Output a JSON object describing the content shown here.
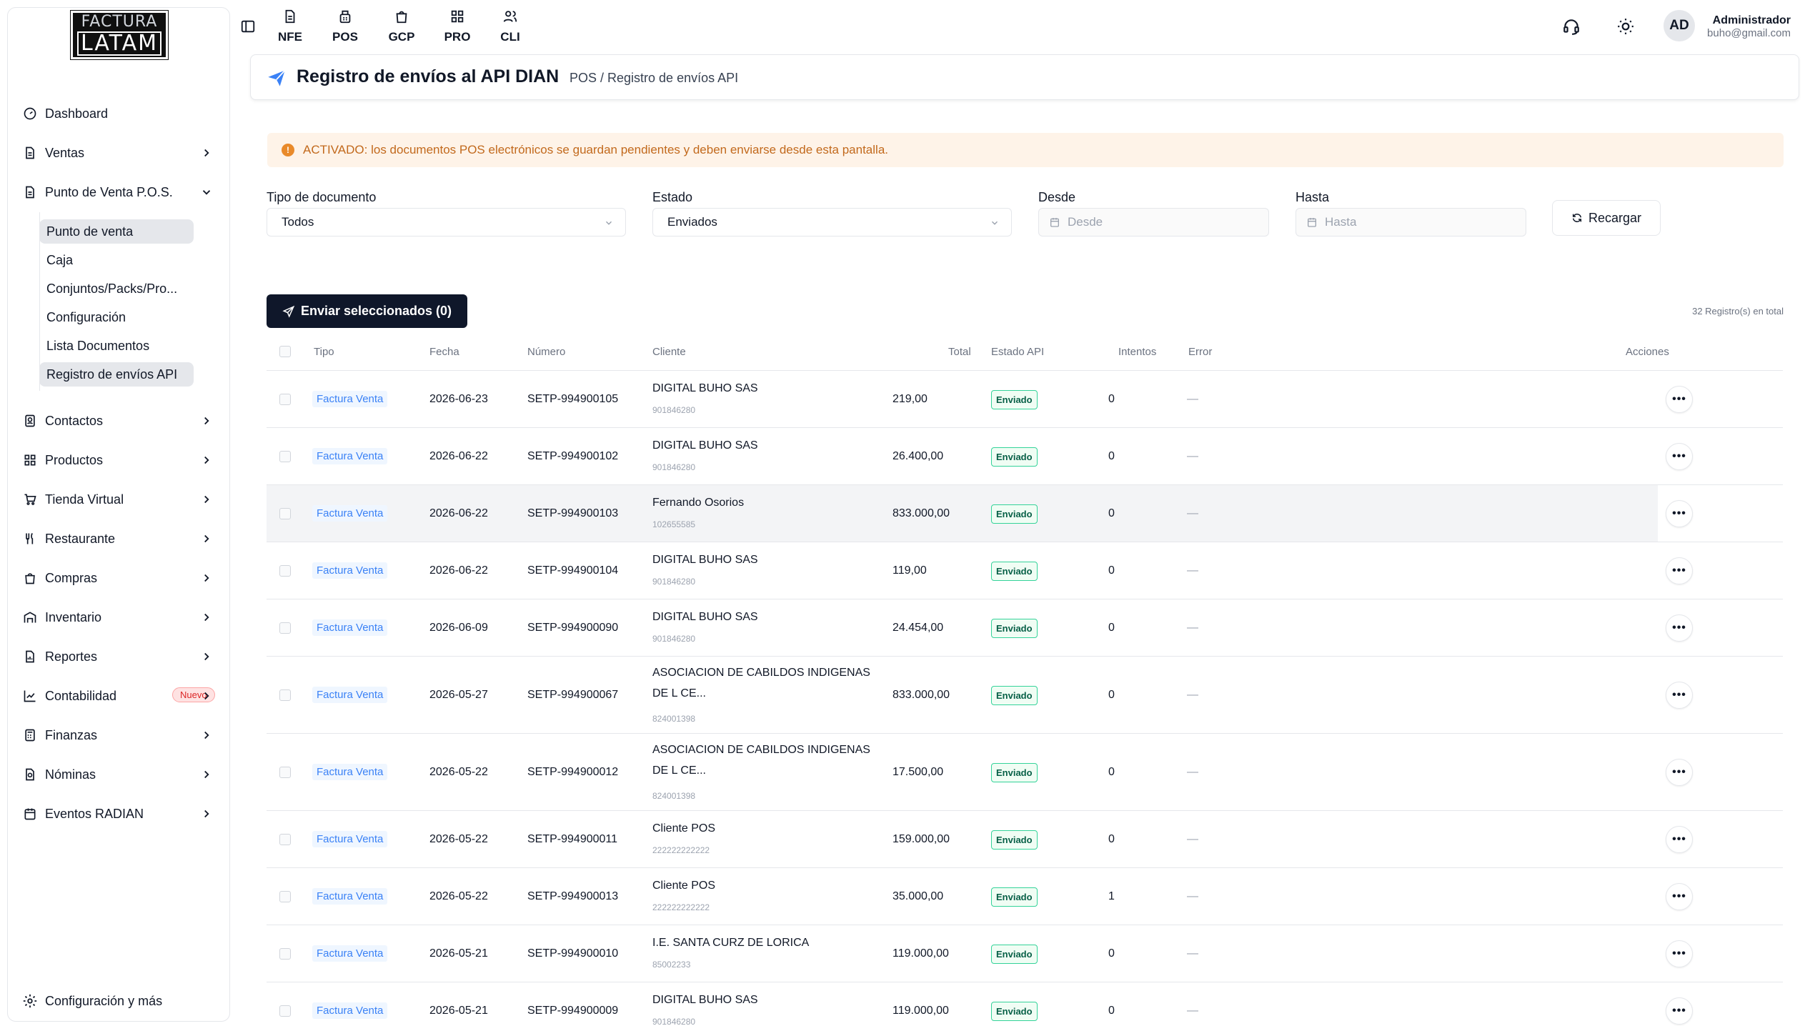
{
  "logo": {
    "line1": "FACTURA",
    "line2": "LATAM"
  },
  "sidebar": {
    "items": [
      {
        "label": "Dashboard",
        "icon": "gauge-icon"
      },
      {
        "label": "Ventas",
        "icon": "document-icon"
      },
      {
        "label": "Punto de Venta P.O.S.",
        "icon": "document-icon"
      },
      {
        "label": "Contactos",
        "icon": "contacts-icon"
      },
      {
        "label": "Productos",
        "icon": "grid-icon"
      },
      {
        "label": "Tienda Virtual",
        "icon": "cart-icon"
      },
      {
        "label": "Restaurante",
        "icon": "utensils-icon"
      },
      {
        "label": "Compras",
        "icon": "shopping-bag-icon"
      },
      {
        "label": "Inventario",
        "icon": "warehouse-icon"
      },
      {
        "label": "Reportes",
        "icon": "report-icon"
      },
      {
        "label": "Contabilidad",
        "icon": "chart-icon",
        "badge": "Nuevo"
      },
      {
        "label": "Finanzas",
        "icon": "calculator-icon"
      },
      {
        "label": "Nóminas",
        "icon": "payroll-icon"
      },
      {
        "label": "Eventos RADIAN",
        "icon": "calendar-icon"
      }
    ],
    "pos_sub": [
      "Punto de venta",
      "Caja",
      "Conjuntos/Packs/Pro...",
      "Configuración",
      "Lista Documentos",
      "Registro de envíos API"
    ],
    "footer": "Configuración y más"
  },
  "topbar": {
    "modules": [
      "NFE",
      "POS",
      "GCP",
      "PRO",
      "CLI"
    ],
    "avatar": "AD",
    "user_name": "Administrador",
    "user_email": "buho@gmail.com"
  },
  "header": {
    "title": "Registro de envíos al API DIAN",
    "breadcrumb": "POS / Registro de envíos API"
  },
  "alert": "ACTIVADO: los documentos POS electrónicos se guardan pendientes y deben enviarse desde esta pantalla.",
  "filters": {
    "tipo_label": "Tipo de documento",
    "tipo_value": "Todos",
    "estado_label": "Estado",
    "estado_value": "Enviados",
    "desde_label": "Desde",
    "desde_placeholder": "Desde",
    "hasta_label": "Hasta",
    "hasta_placeholder": "Hasta",
    "reload": "Recargar"
  },
  "send_selected": "Enviar seleccionados (0)",
  "records_total": "32 Registro(s) en total",
  "table": {
    "headers": {
      "tipo": "Tipo",
      "fecha": "Fecha",
      "numero": "Número",
      "cliente": "Cliente",
      "total": "Total",
      "estado": "Estado API",
      "intentos": "Intentos",
      "error": "Error",
      "acciones": "Acciones"
    },
    "rows": [
      {
        "tipo": "Factura Venta",
        "fecha": "2026-06-23",
        "numero": "SETP-994900105",
        "cliente": "DIGITAL BUHO SAS",
        "nit": "901846280",
        "total": "219,00",
        "estado": "Enviado",
        "intentos": "0",
        "error": "—"
      },
      {
        "tipo": "Factura Venta",
        "fecha": "2026-06-22",
        "numero": "SETP-994900102",
        "cliente": "DIGITAL BUHO SAS",
        "nit": "901846280",
        "total": "26.400,00",
        "estado": "Enviado",
        "intentos": "0",
        "error": "—"
      },
      {
        "tipo": "Factura Venta",
        "fecha": "2026-06-22",
        "numero": "SETP-994900103",
        "cliente": "Fernando Osorios",
        "nit": "102655585",
        "total": "833.000,00",
        "estado": "Enviado",
        "intentos": "0",
        "error": "—"
      },
      {
        "tipo": "Factura Venta",
        "fecha": "2026-06-22",
        "numero": "SETP-994900104",
        "cliente": "DIGITAL BUHO SAS",
        "nit": "901846280",
        "total": "119,00",
        "estado": "Enviado",
        "intentos": "0",
        "error": "—"
      },
      {
        "tipo": "Factura Venta",
        "fecha": "2026-06-09",
        "numero": "SETP-994900090",
        "cliente": "DIGITAL BUHO SAS",
        "nit": "901846280",
        "total": "24.454,00",
        "estado": "Enviado",
        "intentos": "0",
        "error": "—"
      },
      {
        "tipo": "Factura Venta",
        "fecha": "2026-05-27",
        "numero": "SETP-994900067",
        "cliente": "ASOCIACION DE CABILDOS INDIGENAS DE L CE...",
        "nit": "824001398",
        "total": "833.000,00",
        "estado": "Enviado",
        "intentos": "0",
        "error": "—"
      },
      {
        "tipo": "Factura Venta",
        "fecha": "2026-05-22",
        "numero": "SETP-994900012",
        "cliente": "ASOCIACION DE CABILDOS INDIGENAS DE L CE...",
        "nit": "824001398",
        "total": "17.500,00",
        "estado": "Enviado",
        "intentos": "0",
        "error": "—"
      },
      {
        "tipo": "Factura Venta",
        "fecha": "2026-05-22",
        "numero": "SETP-994900011",
        "cliente": "Cliente POS",
        "nit": "222222222222",
        "total": "159.000,00",
        "estado": "Enviado",
        "intentos": "0",
        "error": "—"
      },
      {
        "tipo": "Factura Venta",
        "fecha": "2026-05-22",
        "numero": "SETP-994900013",
        "cliente": "Cliente POS",
        "nit": "222222222222",
        "total": "35.000,00",
        "estado": "Enviado",
        "intentos": "1",
        "error": "—"
      },
      {
        "tipo": "Factura Venta",
        "fecha": "2026-05-21",
        "numero": "SETP-994900010",
        "cliente": "I.E. SANTA CURZ DE LORICA",
        "nit": "85002233",
        "total": "119.000,00",
        "estado": "Enviado",
        "intentos": "0",
        "error": "—"
      },
      {
        "tipo": "Factura Venta",
        "fecha": "2026-05-21",
        "numero": "SETP-994900009",
        "cliente": "DIGITAL BUHO SAS",
        "nit": "901846280",
        "total": "119.000,00",
        "estado": "Enviado",
        "intentos": "0",
        "error": "—"
      }
    ]
  },
  "colors": {
    "accent": "#0f172a",
    "link": "#3b82f6",
    "success": "#34d399",
    "alert": "#c2691c"
  }
}
